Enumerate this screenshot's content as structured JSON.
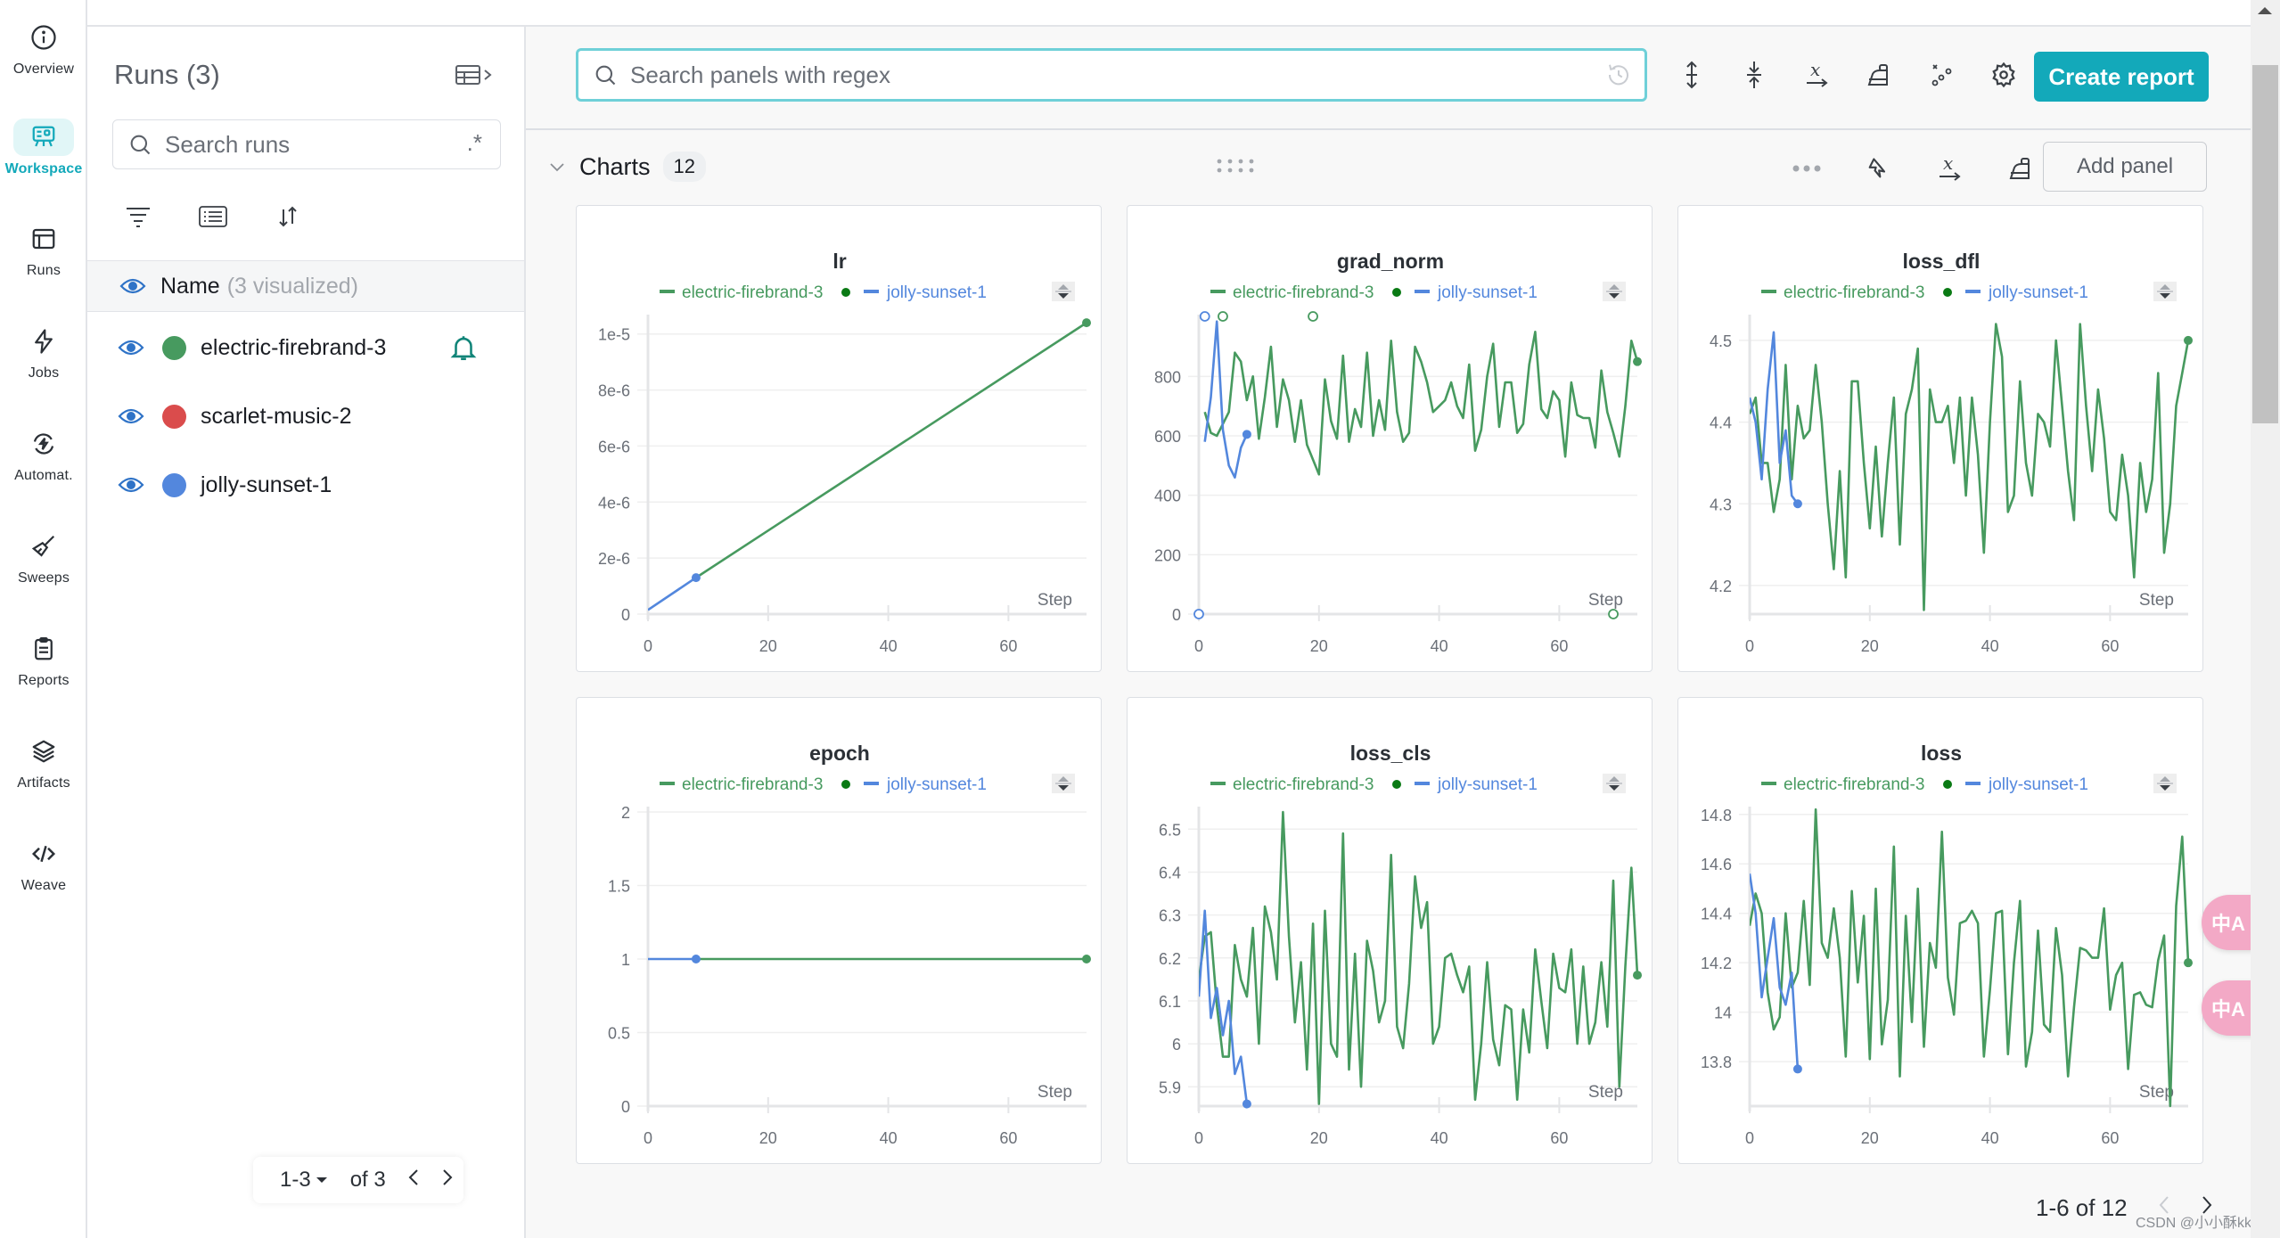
{
  "nav": {
    "items": [
      {
        "label": "Overview",
        "icon": "info-icon"
      },
      {
        "label": "Workspace",
        "icon": "workspace-icon",
        "active": true
      },
      {
        "label": "Runs",
        "icon": "runs-table-icon"
      },
      {
        "label": "Jobs",
        "icon": "lightning-icon"
      },
      {
        "label": "Automat.",
        "icon": "automation-icon"
      },
      {
        "label": "Sweeps",
        "icon": "broom-icon"
      },
      {
        "label": "Reports",
        "icon": "clipboard-icon"
      },
      {
        "label": "Artifacts",
        "icon": "layers-icon"
      },
      {
        "label": "Weave",
        "icon": "code-icon"
      }
    ]
  },
  "runs_panel": {
    "title": "Runs (3)",
    "search_placeholder": "Search runs",
    "regex_label": ".*",
    "header_name": "Name",
    "header_visualized": "(3 visualized)",
    "runs": [
      {
        "name": "electric-firebrand-3",
        "color": "#479a5f",
        "visible": true,
        "alert_bell": true
      },
      {
        "name": "scarlet-music-2",
        "color": "#da4c4c",
        "visible": true,
        "alert_bell": false
      },
      {
        "name": "jolly-sunset-1",
        "color": "#5387dd",
        "visible": true,
        "alert_bell": false
      }
    ],
    "pager": {
      "range": "1-3",
      "of": "of 3"
    }
  },
  "main": {
    "search_placeholder": "Search panels with regex",
    "create_report_label": "Create report",
    "section_title": "Charts",
    "section_count": "12",
    "add_panel_label": "Add panel",
    "pagination": "1-6 of 12",
    "accent_color": "#13a9ba",
    "translate_label": "中A",
    "watermark": "CSDN @小小酥kkk"
  },
  "legend": {
    "series": [
      {
        "name": "electric-firebrand-3",
        "color": "#479a5f",
        "running": true
      },
      {
        "name": "jolly-sunset-1",
        "color": "#5387dd"
      }
    ],
    "x_axis_label": "Step"
  },
  "chart_data": [
    {
      "type": "line",
      "title": "lr",
      "xlabel": "Step",
      "ylabel": "",
      "xlim": [
        0,
        73
      ],
      "ylim": [
        0,
        1.05e-05
      ],
      "xticks": [
        0,
        20,
        40,
        60
      ],
      "yticks": [
        0,
        2e-06,
        4e-06,
        6e-06,
        8e-06,
        1e-05
      ],
      "ytick_labels": [
        "0",
        "2e-6",
        "4e-6",
        "6e-6",
        "8e-6",
        "1e-5"
      ],
      "series": [
        {
          "name": "jolly-sunset-1",
          "x": [
            0,
            8
          ],
          "y": [
            1.5e-07,
            1.3e-06
          ]
        },
        {
          "name": "electric-firebrand-3",
          "x": [
            8,
            73
          ],
          "y": [
            1.3e-06,
            1.04e-05
          ]
        }
      ]
    },
    {
      "type": "line",
      "title": "grad_norm",
      "xlabel": "Step",
      "ylabel": "",
      "xlim": [
        0,
        73
      ],
      "ylim": [
        0,
        990
      ],
      "xticks": [
        0,
        20,
        40,
        60
      ],
      "yticks": [
        0,
        200,
        400,
        600,
        800
      ],
      "ytick_labels": [
        "0",
        "200",
        "400",
        "600",
        "800"
      ],
      "series": [
        {
          "name": "jolly-sunset-1",
          "x": [
            1,
            2,
            3,
            4,
            5,
            6,
            7,
            8
          ],
          "y": [
            580,
            730,
            985,
            620,
            500,
            460,
            560,
            605
          ]
        },
        {
          "name": "electric-firebrand-3",
          "x": [
            1,
            2,
            3,
            4,
            5,
            6,
            7,
            8,
            9,
            10,
            11,
            12,
            13,
            14,
            15,
            16,
            17,
            18,
            19,
            20,
            21,
            22,
            23,
            24,
            25,
            26,
            27,
            28,
            29,
            30,
            31,
            32,
            33,
            34,
            35,
            36,
            37,
            38,
            39,
            40,
            41,
            42,
            43,
            44,
            45,
            46,
            47,
            48,
            49,
            50,
            51,
            52,
            53,
            54,
            55,
            56,
            57,
            58,
            59,
            60,
            61,
            62,
            63,
            64,
            65,
            66,
            67,
            68,
            69,
            70,
            71,
            72,
            73
          ],
          "y": [
            680,
            610,
            600,
            640,
            680,
            880,
            850,
            720,
            800,
            590,
            730,
            900,
            630,
            790,
            720,
            580,
            720,
            570,
            520,
            470,
            790,
            650,
            590,
            870,
            580,
            690,
            630,
            880,
            600,
            720,
            620,
            920,
            680,
            580,
            610,
            900,
            850,
            780,
            680,
            700,
            720,
            780,
            700,
            660,
            840,
            550,
            620,
            800,
            910,
            630,
            780,
            780,
            610,
            640,
            840,
            950,
            690,
            660,
            750,
            720,
            530,
            780,
            670,
            660,
            660,
            560,
            820,
            680,
            610,
            530,
            700,
            920,
            850
          ]
        }
      ],
      "outlier_markers": [
        {
          "x": 1,
          "y": "above",
          "series": "jolly-sunset-1"
        },
        {
          "x": 4,
          "y": "above",
          "series": "electric-firebrand-3"
        },
        {
          "x": 19,
          "y": "above",
          "series": "electric-firebrand-3"
        },
        {
          "x": 0,
          "y": "below",
          "series": "jolly-sunset-1"
        },
        {
          "x": 69,
          "y": "below",
          "series": "electric-firebrand-3"
        }
      ]
    },
    {
      "type": "line",
      "title": "loss_dfl",
      "xlabel": "Step",
      "ylabel": "",
      "xlim": [
        0,
        73
      ],
      "ylim": [
        4.165,
        4.525
      ],
      "xticks": [
        0,
        20,
        40,
        60
      ],
      "yticks": [
        4.2,
        4.3,
        4.4,
        4.5
      ],
      "ytick_labels": [
        "4.2",
        "4.3",
        "4.4",
        "4.5"
      ],
      "series": [
        {
          "name": "jolly-sunset-1",
          "x": [
            0,
            1,
            2,
            3,
            4,
            5,
            6,
            7,
            8
          ],
          "y": [
            4.43,
            4.4,
            4.33,
            4.44,
            4.51,
            4.35,
            4.39,
            4.31,
            4.3
          ]
        },
        {
          "name": "electric-firebrand-3",
          "x": [
            0,
            1,
            2,
            3,
            4,
            5,
            6,
            7,
            8,
            9,
            10,
            11,
            12,
            13,
            14,
            15,
            16,
            17,
            18,
            19,
            20,
            21,
            22,
            23,
            24,
            25,
            26,
            27,
            28,
            29,
            30,
            31,
            32,
            33,
            34,
            35,
            36,
            37,
            38,
            39,
            40,
            41,
            42,
            43,
            44,
            45,
            46,
            47,
            48,
            49,
            50,
            51,
            52,
            53,
            54,
            55,
            56,
            57,
            58,
            59,
            60,
            61,
            62,
            63,
            64,
            65,
            66,
            67,
            68,
            69,
            70,
            71,
            72,
            73
          ],
          "y": [
            4.41,
            4.43,
            4.35,
            4.35,
            4.29,
            4.33,
            4.47,
            4.33,
            4.42,
            4.38,
            4.39,
            4.47,
            4.4,
            4.3,
            4.22,
            4.34,
            4.21,
            4.45,
            4.45,
            4.35,
            4.27,
            4.37,
            4.26,
            4.35,
            4.43,
            4.25,
            4.41,
            4.44,
            4.49,
            4.17,
            4.44,
            4.4,
            4.4,
            4.42,
            4.35,
            4.43,
            4.31,
            4.43,
            4.36,
            4.24,
            4.4,
            4.52,
            4.48,
            4.29,
            4.31,
            4.45,
            4.35,
            4.31,
            4.41,
            4.4,
            4.37,
            4.5,
            4.42,
            4.34,
            4.28,
            4.52,
            4.42,
            4.34,
            4.44,
            4.38,
            4.29,
            4.28,
            4.36,
            4.31,
            4.21,
            4.35,
            4.29,
            4.33,
            4.46,
            4.24,
            4.3,
            4.42,
            4.46,
            4.5
          ]
        }
      ]
    },
    {
      "type": "line",
      "title": "epoch",
      "xlabel": "Step",
      "ylabel": "",
      "xlim": [
        0,
        73
      ],
      "ylim": [
        0,
        2
      ],
      "xticks": [
        0,
        20,
        40,
        60
      ],
      "yticks": [
        0,
        0.5,
        1,
        1.5,
        2
      ],
      "ytick_labels": [
        "0",
        "0.5",
        "1",
        "1.5",
        "2"
      ],
      "series": [
        {
          "name": "jolly-sunset-1",
          "x": [
            0,
            8
          ],
          "y": [
            1,
            1
          ]
        },
        {
          "name": "electric-firebrand-3",
          "x": [
            8,
            73
          ],
          "y": [
            1,
            1
          ]
        }
      ]
    },
    {
      "type": "line",
      "title": "loss_cls",
      "xlabel": "Step",
      "ylabel": "",
      "xlim": [
        0,
        73
      ],
      "ylim": [
        5.855,
        6.54
      ],
      "xticks": [
        0,
        20,
        40,
        60
      ],
      "yticks": [
        5.9,
        6,
        6.1,
        6.2,
        6.3,
        6.4,
        6.5
      ],
      "ytick_labels": [
        "5.9",
        "6",
        "6.1",
        "6.2",
        "6.3",
        "6.4",
        "6.5"
      ],
      "series": [
        {
          "name": "jolly-sunset-1",
          "x": [
            0,
            1,
            2,
            3,
            4,
            5,
            6,
            7,
            8
          ],
          "y": [
            6.11,
            6.31,
            6.06,
            6.13,
            6.02,
            6.1,
            5.93,
            5.97,
            5.86
          ]
        },
        {
          "name": "electric-firebrand-3",
          "x": [
            0,
            1,
            2,
            3,
            4,
            5,
            6,
            7,
            8,
            9,
            10,
            11,
            12,
            13,
            14,
            15,
            16,
            17,
            18,
            19,
            20,
            21,
            22,
            23,
            24,
            25,
            26,
            27,
            28,
            29,
            30,
            31,
            32,
            33,
            34,
            35,
            36,
            37,
            38,
            39,
            40,
            41,
            42,
            43,
            44,
            45,
            46,
            47,
            48,
            49,
            50,
            51,
            52,
            53,
            54,
            55,
            56,
            57,
            58,
            59,
            60,
            61,
            62,
            63,
            64,
            65,
            66,
            67,
            68,
            69,
            70,
            71,
            72,
            73
          ],
          "y": [
            6.15,
            6.25,
            6.26,
            6.09,
            5.97,
            5.97,
            6.23,
            6.15,
            6.11,
            6.27,
            6.0,
            6.32,
            6.26,
            6.15,
            6.54,
            6.25,
            6.05,
            6.19,
            5.94,
            6.28,
            5.86,
            6.31,
            6.0,
            5.97,
            6.49,
            5.94,
            6.21,
            5.9,
            6.24,
            6.17,
            6.05,
            6.1,
            6.44,
            6.04,
            5.99,
            6.14,
            6.39,
            6.27,
            6.33,
            6.0,
            6.04,
            6.2,
            6.21,
            6.16,
            6.12,
            6.18,
            5.87,
            6.0,
            6.19,
            6.01,
            5.95,
            6.09,
            6.08,
            5.87,
            6.08,
            5.98,
            6.22,
            6.1,
            5.99,
            6.21,
            6.13,
            6.12,
            6.22,
            6.0,
            6.18,
            6.0,
            6.05,
            6.19,
            6.04,
            6.38,
            5.9,
            6.18,
            6.41,
            6.16
          ]
        }
      ]
    },
    {
      "type": "line",
      "title": "loss",
      "xlabel": "Step",
      "ylabel": "",
      "xlim": [
        0,
        73
      ],
      "ylim": [
        13.62,
        14.81
      ],
      "xticks": [
        0,
        20,
        40,
        60
      ],
      "yticks": [
        13.8,
        14,
        14.2,
        14.4,
        14.6,
        14.8
      ],
      "ytick_labels": [
        "13.8",
        "14",
        "14.2",
        "14.4",
        "14.6",
        "14.8"
      ],
      "series": [
        {
          "name": "jolly-sunset-1",
          "x": [
            0,
            1,
            2,
            3,
            4,
            5,
            6,
            7,
            8
          ],
          "y": [
            14.56,
            14.4,
            14.06,
            14.22,
            14.38,
            14.1,
            14.03,
            14.16,
            13.77
          ]
        },
        {
          "name": "electric-firebrand-3",
          "x": [
            0,
            1,
            2,
            3,
            4,
            5,
            6,
            7,
            8,
            9,
            10,
            11,
            12,
            13,
            14,
            15,
            16,
            17,
            18,
            19,
            20,
            21,
            22,
            23,
            24,
            25,
            26,
            27,
            28,
            29,
            30,
            31,
            32,
            33,
            34,
            35,
            36,
            37,
            38,
            39,
            40,
            41,
            42,
            43,
            44,
            45,
            46,
            47,
            48,
            49,
            50,
            51,
            52,
            53,
            54,
            55,
            56,
            57,
            58,
            59,
            60,
            61,
            62,
            63,
            64,
            65,
            66,
            67,
            68,
            69,
            70,
            71,
            72,
            73
          ],
          "y": [
            14.35,
            14.48,
            14.4,
            14.08,
            13.93,
            13.98,
            14.4,
            14.1,
            14.16,
            14.45,
            14.11,
            14.82,
            14.28,
            14.22,
            14.42,
            14.22,
            13.82,
            14.49,
            14.12,
            14.39,
            13.81,
            14.5,
            13.87,
            14.05,
            14.67,
            13.74,
            14.39,
            13.96,
            14.5,
            13.86,
            14.28,
            14.18,
            14.73,
            14.14,
            13.99,
            14.36,
            14.37,
            14.41,
            14.36,
            13.82,
            14.09,
            14.4,
            14.41,
            13.83,
            14.2,
            14.45,
            13.78,
            13.92,
            14.33,
            13.95,
            13.92,
            14.34,
            14.15,
            13.74,
            14.02,
            14.26,
            14.25,
            14.22,
            14.22,
            14.42,
            14.01,
            14.15,
            14.2,
            13.77,
            14.07,
            14.08,
            14.03,
            14.02,
            14.21,
            14.31,
            13.62,
            14.43,
            14.71,
            14.2
          ]
        }
      ]
    }
  ]
}
